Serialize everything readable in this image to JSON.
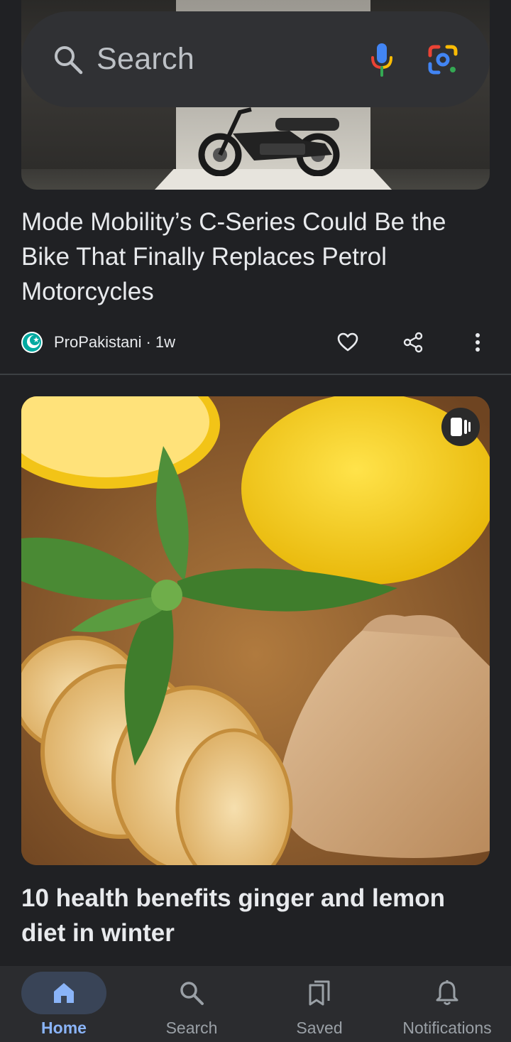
{
  "search": {
    "placeholder": "Search"
  },
  "articles": [
    {
      "title": "Mode Mobility’s C-Series Could Be the Bike That Finally Replaces Petrol Motorcycles",
      "publisher": "ProPakistani",
      "separator": "·",
      "age": "1w",
      "image": "electric-motorbike-photo"
    },
    {
      "title": "10 health benefits ginger and lemon diet in winter",
      "image": "ginger-lemon-mint-photo",
      "badge": "web-story-icon"
    }
  ],
  "nav": {
    "items": [
      {
        "label": "Home",
        "icon": "home-icon",
        "active": true
      },
      {
        "label": "Search",
        "icon": "search-icon",
        "active": false
      },
      {
        "label": "Saved",
        "icon": "saved-icon",
        "active": false
      },
      {
        "label": "Notifications",
        "icon": "bell-icon",
        "active": false
      }
    ]
  },
  "colors": {
    "background": "#202124",
    "surface": "#303134",
    "accent": "#8ab4f8",
    "text": "#e8eaed",
    "muted": "#9aa0a6"
  }
}
